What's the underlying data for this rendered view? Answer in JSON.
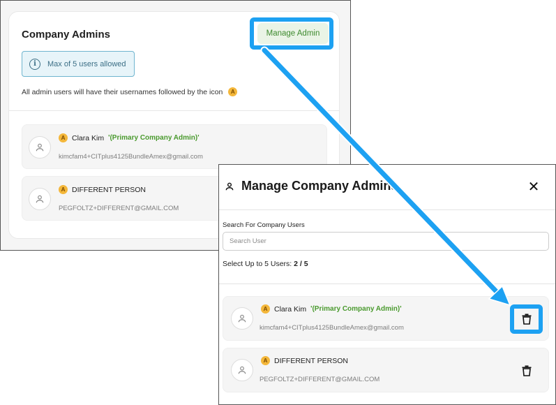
{
  "admins_panel": {
    "title": "Company Admins",
    "manage_button": "Manage Admin",
    "info_text": "Max of 5 users allowed",
    "note": "All admin users will have their usernames followed by the icon",
    "badge_letter": "A",
    "users": [
      {
        "name": "Clara Kim",
        "tag": "'(Primary Company Admin)'",
        "email": "kimcfam4+CITplus4125BundleAmex@gmail.com"
      },
      {
        "name": "DIFFERENT PERSON",
        "tag": "",
        "email": "PEGFOLTZ+DIFFERENT@GMAIL.COM"
      }
    ]
  },
  "modal": {
    "title": "Manage Company Admins",
    "close_glyph": "✕",
    "search_label": "Search For Company Users",
    "search_placeholder": "Search User",
    "select_prefix": "Select Up to 5 Users:",
    "select_count": "2 / 5",
    "users": [
      {
        "name": "Clara Kim",
        "tag": "'(Primary Company Admin)'",
        "email": "kimcfam4+CITplus4125BundleAmex@gmail.com"
      },
      {
        "name": "DIFFERENT PERSON",
        "tag": "",
        "email": "PEGFOLTZ+DIFFERENT@GMAIL.COM"
      }
    ]
  },
  "colors": {
    "highlight": "#1da1f2",
    "primary_tag": "#4a9a2e",
    "badge": "#f4b73a",
    "info_border": "#6fb5cf"
  },
  "icons": {
    "info": "info-circle-icon",
    "user": "user-icon",
    "trash": "trash-icon",
    "close": "close-icon",
    "admin_badge": "admin-badge-icon"
  }
}
